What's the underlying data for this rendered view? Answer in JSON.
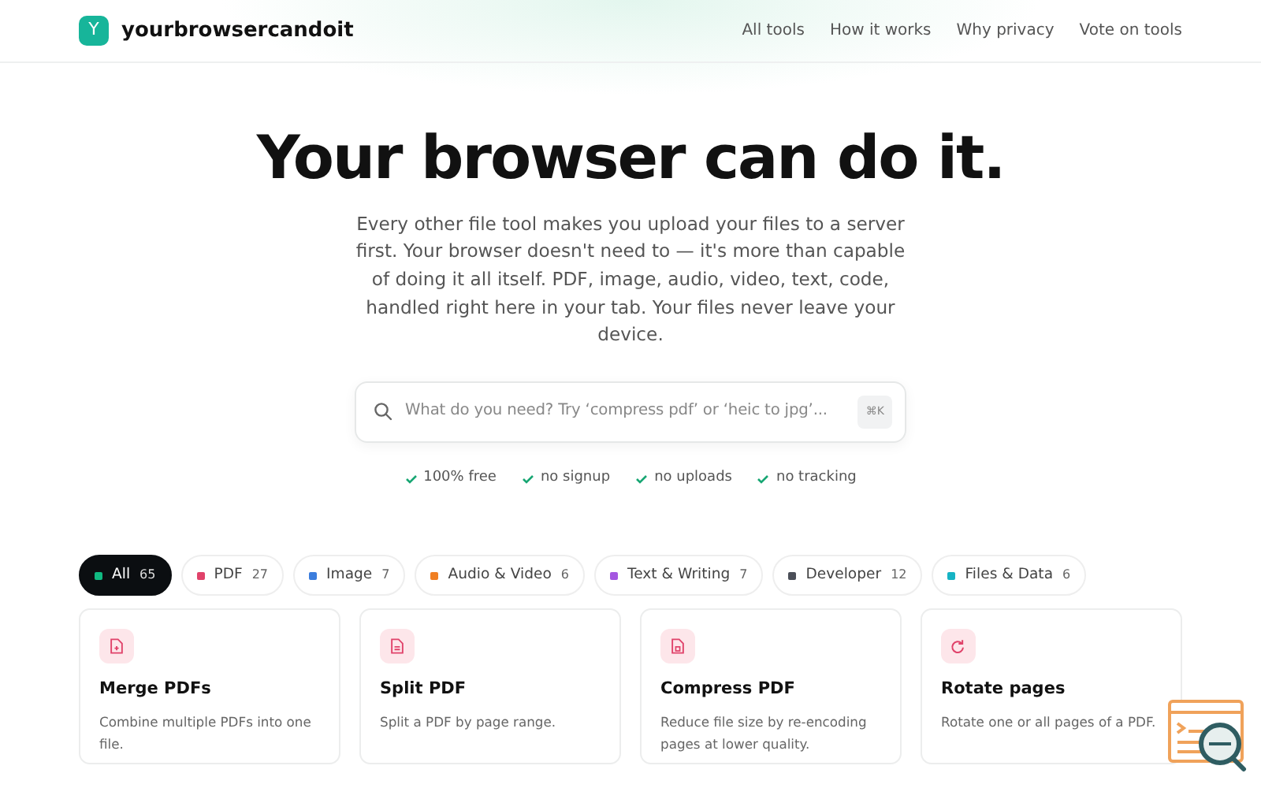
{
  "brand": {
    "logo_letter": "Y",
    "name": "yourbrowsercandoit"
  },
  "nav": [
    {
      "label": "All tools"
    },
    {
      "label": "How it works"
    },
    {
      "label": "Why privacy"
    },
    {
      "label": "Vote on tools"
    }
  ],
  "hero": {
    "title": "Your browser can do it.",
    "subtitle": "Every other file tool makes you upload your files to a server first. Your browser doesn't need to — it's more than capable of doing it all itself. PDF, image, audio, video, text, code, handled right here in your tab. Your files never leave your device."
  },
  "search": {
    "placeholder": "What do you need? Try ‘compress pdf’ or ‘heic to jpg’...",
    "shortcut": "⌘K"
  },
  "perks": [
    {
      "label": "100% free"
    },
    {
      "label": "no signup"
    },
    {
      "label": "no uploads"
    },
    {
      "label": "no tracking"
    }
  ],
  "categories": [
    {
      "label": "All",
      "count": "65",
      "color": "#10b981",
      "selected": true
    },
    {
      "label": "PDF",
      "count": "27",
      "color": "#e0426a",
      "selected": false
    },
    {
      "label": "Image",
      "count": "7",
      "color": "#3b7ddd",
      "selected": false
    },
    {
      "label": "Audio & Video",
      "count": "6",
      "color": "#f07f22",
      "selected": false
    },
    {
      "label": "Text & Writing",
      "count": "7",
      "color": "#a457e0",
      "selected": false
    },
    {
      "label": "Developer",
      "count": "12",
      "color": "#4b4f58",
      "selected": false
    },
    {
      "label": "Files & Data",
      "count": "6",
      "color": "#16b3c4",
      "selected": false
    }
  ],
  "tools": [
    {
      "title": "Merge PDFs",
      "description": "Combine multiple PDFs into one file."
    },
    {
      "title": "Split PDF",
      "description": "Split a PDF by page range."
    },
    {
      "title": "Compress PDF",
      "description": "Reduce file size by re-encoding pages at lower quality."
    },
    {
      "title": "Rotate pages",
      "description": "Rotate one or all pages of a PDF."
    }
  ]
}
